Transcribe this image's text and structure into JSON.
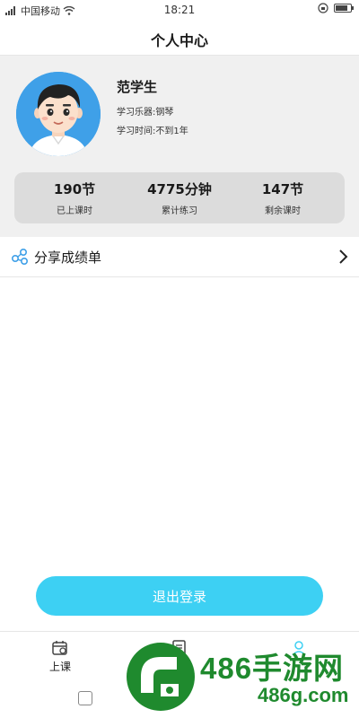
{
  "status_bar": {
    "carrier": "中国移动",
    "time": "18:21",
    "battery_level": 0.8
  },
  "header": {
    "title": "个人中心"
  },
  "profile": {
    "name": "范学生",
    "instrument": "学习乐器:钢琴",
    "study_time": "学习时间:不到1年"
  },
  "stats": [
    {
      "value": "190节",
      "label": "已上课时"
    },
    {
      "value": "4775分钟",
      "label": "累计练习"
    },
    {
      "value": "147节",
      "label": "剩余课时"
    }
  ],
  "share": {
    "label": "分享成绩单"
  },
  "logout_label": "退出登录",
  "tabs": [
    {
      "label": "上课",
      "icon": "calendar-icon"
    },
    {
      "label": "",
      "icon": "document-icon"
    },
    {
      "label": "",
      "icon": "person-icon"
    }
  ],
  "watermark": {
    "main": "486手游网",
    "sub": "486g.com"
  },
  "colors": {
    "accent": "#3dd0f3",
    "avatar_bg": "#3fa0e8",
    "watermark": "#1f8a2e"
  }
}
